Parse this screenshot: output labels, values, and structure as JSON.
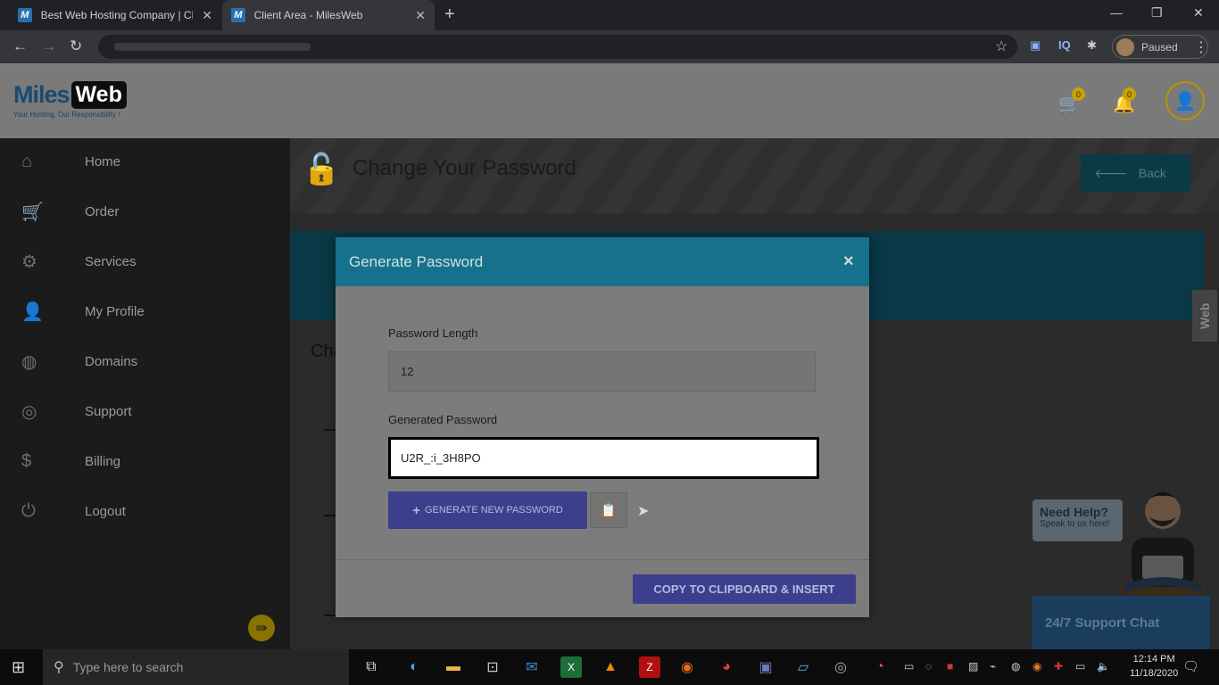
{
  "browser": {
    "tabs": [
      {
        "title": "Best Web Hosting Company | Ch",
        "favicon": "M"
      },
      {
        "title": "Client Area - MilesWeb",
        "favicon": "M"
      }
    ],
    "profile_status": "Paused"
  },
  "header": {
    "logo_miles": "Miles",
    "logo_web": "Web",
    "logo_tagline": "Your Hosting, Our Responsibility !",
    "cart_count": "0",
    "notification_count": "0"
  },
  "sidebar": {
    "items": [
      {
        "label": "Home",
        "icon": "home-icon"
      },
      {
        "label": "Order",
        "icon": "cart-icon"
      },
      {
        "label": "Services",
        "icon": "gears-icon"
      },
      {
        "label": "My Profile",
        "icon": "user-icon"
      },
      {
        "label": "Domains",
        "icon": "globe-icon"
      },
      {
        "label": "Support",
        "icon": "lifebuoy-icon"
      },
      {
        "label": "Billing",
        "icon": "dollar-icon"
      },
      {
        "label": "Logout",
        "icon": "power-icon"
      }
    ]
  },
  "page": {
    "title": "Change Your Password",
    "back_label": "Back",
    "background_heading": "Cha"
  },
  "modal": {
    "title": "Generate Password",
    "close_symbol": "×",
    "length_label": "Password Length",
    "length_value": "12",
    "generated_label": "Generated Password",
    "generated_value": "U2R_:i_3H8PO",
    "generate_button": "GENERATE NEW PASSWORD",
    "insert_button": "COPY TO CLIPBOARD & INSERT"
  },
  "chat": {
    "need_help": "Need Help?",
    "speak": "Speak to us here!",
    "support_chat": "24/7 Support Chat",
    "side_tab": "Web"
  },
  "taskbar": {
    "search_placeholder": "Type here to search",
    "time": "12:14 PM",
    "date": "11/18/2020"
  },
  "colors": {
    "header_teal": "#16728c",
    "button_indigo": "#3c3f8c",
    "accent_gold": "#b89400"
  }
}
